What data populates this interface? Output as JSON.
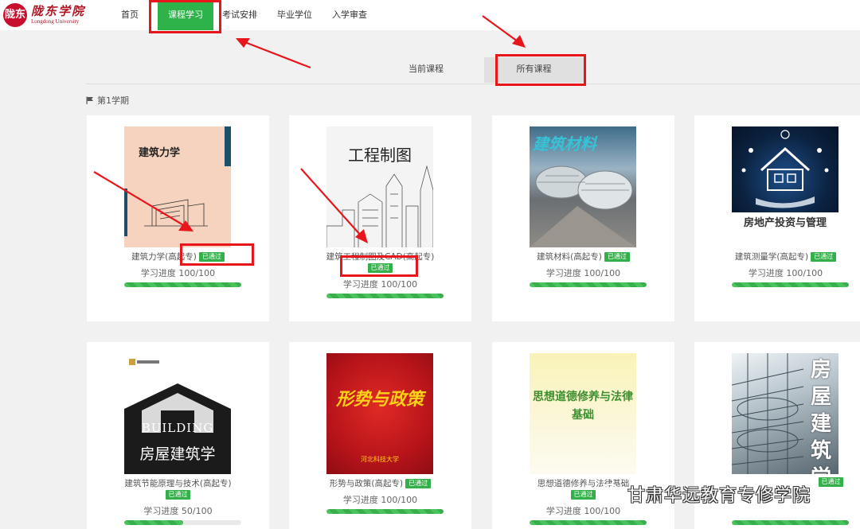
{
  "header": {
    "logo": {
      "seal_text": "陇东",
      "name": "陇东学院",
      "sub": "Longdong University"
    },
    "nav": [
      {
        "label": "首页"
      },
      {
        "label": "课程学习"
      },
      {
        "label": "考试安排"
      },
      {
        "label": "毕业学位"
      },
      {
        "label": "入学审查"
      }
    ],
    "active_nav": "课程学习"
  },
  "tabs": [
    {
      "label": "当前课程"
    },
    {
      "label": "所有课程"
    }
  ],
  "active_tab": "所有课程",
  "term_label": "第1学期",
  "badge_label": "已通过",
  "courses": [
    {
      "name": "建筑力学(高起专)",
      "cover_title": "建筑力学",
      "passed": true,
      "progress_text": "学习进度 100/100",
      "progress": 100
    },
    {
      "name": "建筑工程制图及CAD(高起专)",
      "cover_title": "工程制图",
      "passed": true,
      "progress_text": "学习进度 100/100",
      "progress": 100
    },
    {
      "name": "建筑材料(高起专)",
      "cover_title": "建筑材料",
      "passed": true,
      "progress_text": "学习进度 100/100",
      "progress": 100
    },
    {
      "name": "建筑测量学(高起专)",
      "cover_title": "房地产投资与管理",
      "passed": true,
      "progress_text": "学习进度 100/100",
      "progress": 100
    },
    {
      "name": "建筑节能原理与技术(高起专)",
      "cover_title": "房屋建筑学",
      "cover_sub": "BUILDING",
      "passed": true,
      "progress_text": "学习进度 50/100",
      "progress": 50
    },
    {
      "name": "形势与政策(高起专)",
      "cover_title": "形势与政策",
      "cover_pub": "河北科技大学",
      "passed": true,
      "progress_text": "学习进度 100/100",
      "progress": 100
    },
    {
      "name": "思想道德修养与法律基础",
      "cover_title": "思想道德修养与法律基础",
      "passed": true,
      "progress_text": "学习进度 100/100",
      "progress": 100
    },
    {
      "name": "",
      "cover_title": "房屋建筑学",
      "passed": true,
      "progress_text": "",
      "progress": 100
    }
  ],
  "watermark": "甘肃华远教育专修学院",
  "colors": {
    "accent": "#2eb24a",
    "annotation": "#e8161b",
    "brand": "#b01524"
  }
}
